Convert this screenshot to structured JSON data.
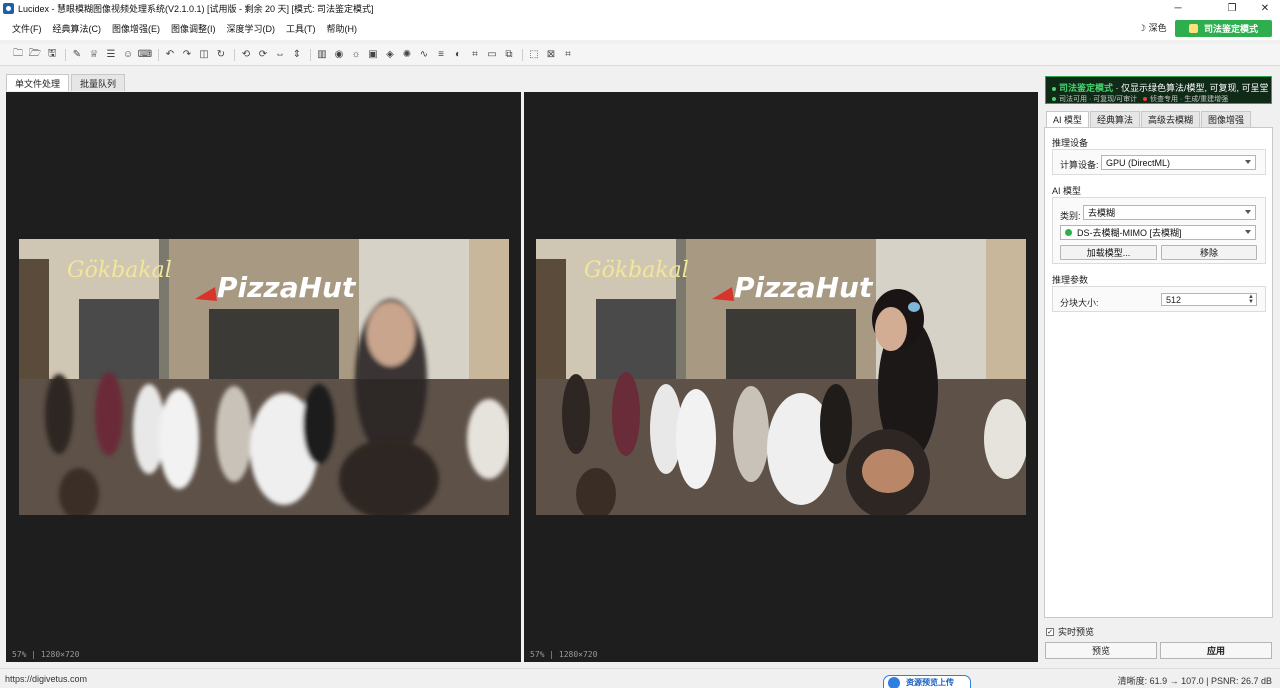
{
  "window": {
    "title": "Lucidex - 慧眼模糊图像视频处理系统(V2.1.0.1) [试用版 - 剩余 20 天] [模式: 司法鉴定模式]",
    "controls": [
      "─",
      "❐",
      "✕"
    ]
  },
  "menu": {
    "items": [
      "文件(F)",
      "经典算法(C)",
      "图像增强(E)",
      "图像调整(I)",
      "深度学习(D)",
      "工具(T)",
      "帮助(H)"
    ],
    "theme_label": "深色",
    "forensic_button": "司法鉴定模式"
  },
  "toolbar": {
    "icons": [
      [
        "open-icon",
        "🗀"
      ],
      [
        "open-folder-icon",
        "🗁"
      ],
      [
        "save-icon",
        "🖫"
      ],
      "sep",
      [
        "pin-icon",
        "✎"
      ],
      [
        "trophy-icon",
        "♕"
      ],
      [
        "stack-icon",
        "☰"
      ],
      [
        "face-icon",
        "☺"
      ],
      [
        "keyboard-icon",
        "⌨"
      ],
      "sep",
      [
        "undo-icon",
        "↶"
      ],
      [
        "redo-icon",
        "↷"
      ],
      [
        "compare-icon",
        "◫"
      ],
      [
        "refresh-icon",
        "↻"
      ],
      "sep",
      [
        "rotate-left-icon",
        "⟲"
      ],
      [
        "rotate-right-icon",
        "⟳"
      ],
      [
        "flip-h-icon",
        "⇔"
      ],
      [
        "flip-v-icon",
        "⇕"
      ],
      "sep",
      [
        "histogram-icon",
        "▥"
      ],
      [
        "color-icon",
        "◉"
      ],
      [
        "brightness-icon",
        "☼"
      ],
      [
        "image-icon",
        "▣"
      ],
      [
        "shapes-icon",
        "◈"
      ],
      [
        "sun-icon",
        "✺"
      ],
      [
        "curve-icon",
        "∿"
      ],
      [
        "levels-icon",
        "≡"
      ],
      [
        "contrast-icon",
        "◐"
      ],
      [
        "crop-icon",
        "⌗"
      ],
      [
        "frame-icon",
        "▭"
      ],
      [
        "layers-icon",
        "⧉"
      ],
      "sep",
      [
        "select-icon",
        "⬚"
      ],
      [
        "clear-icon",
        "⊠"
      ],
      [
        "crop-tool-icon",
        "⌗"
      ]
    ]
  },
  "tabs": {
    "single": "单文件处理",
    "batch": "批量队列"
  },
  "viewers": {
    "left_zoom": "57%  |  1280×720",
    "right_zoom": "57%  |  1280×720"
  },
  "banner": {
    "mode_name": "司法鉴定模式",
    "mode_desc": " · 仅显示绿色算法/模型, 可复现, 可呈堂",
    "legend_green": "司法可用 · 可复现/可审计",
    "legend_red": "侦查专用 · 生成/重建增强"
  },
  "right_tabs": [
    "AI 模型",
    "经典算法",
    "高级去模糊",
    "图像增强"
  ],
  "panel": {
    "device_section": "推理设备",
    "device_label": "计算设备:",
    "device_value": "GPU (DirectML)",
    "model_section": "AI 模型",
    "category_label": "类别:",
    "category_value": "去模糊",
    "model_value": "DS-去模糊-MIMO [去模糊]",
    "load_button": "加载模型...",
    "remove_button": "移除",
    "params_section": "推理参数",
    "tile_label": "分块大小:",
    "tile_value": "512"
  },
  "bottom": {
    "realtime_label": "实时预览",
    "realtime_checked": true,
    "preview_button": "预览",
    "apply_button": "应用"
  },
  "status": {
    "url": "https://digivetus.com",
    "upload_label": "资源预览上传",
    "metrics": "清晰度: 61.9 → 107.0  |  PSNR: 26.7 dB"
  },
  "colors": {
    "accent_green": "#2fae4f",
    "viewer_bg": "#1e1e1e"
  }
}
